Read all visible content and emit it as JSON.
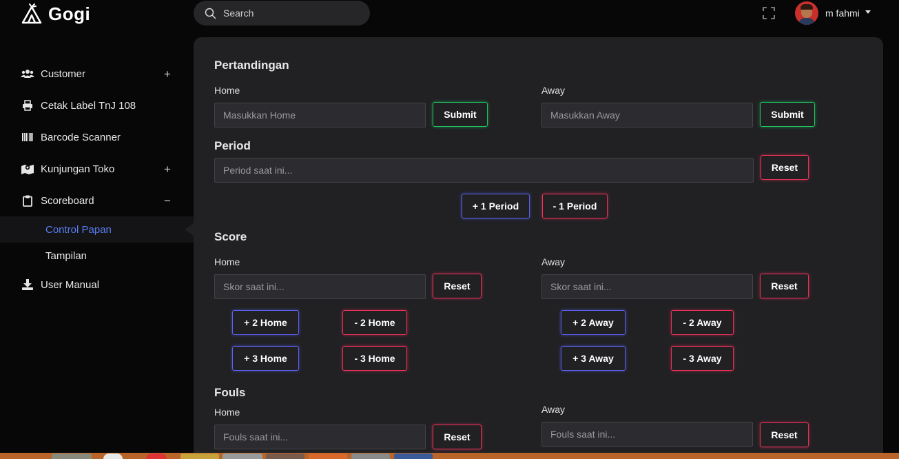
{
  "app": {
    "name": "Gogi"
  },
  "search": {
    "placeholder": "Search"
  },
  "user": {
    "name": "m fahmi"
  },
  "sidebar": {
    "items": [
      {
        "label": "Customer",
        "icon": "users-icon",
        "toggle": "+"
      },
      {
        "label": "Cetak Label TnJ 108",
        "icon": "printer-icon"
      },
      {
        "label": "Barcode Scanner",
        "icon": "barcode-icon"
      },
      {
        "label": "Kunjungan Toko",
        "icon": "map-icon",
        "toggle": "+"
      },
      {
        "label": "Scoreboard",
        "icon": "clipboard-icon",
        "toggle": "−"
      },
      {
        "label": "User Manual",
        "icon": "download-icon"
      }
    ],
    "subitems": [
      {
        "label": "Control Papan",
        "active": true
      },
      {
        "label": "Tampilan",
        "active": false
      }
    ]
  },
  "pertandingan": {
    "title": "Pertandingan",
    "home_label": "Home",
    "away_label": "Away",
    "home_placeholder": "Masukkan Home",
    "away_placeholder": "Masukkan Away",
    "submit_label": "Submit"
  },
  "period": {
    "title": "Period",
    "placeholder": "Period saat ini...",
    "reset_label": "Reset",
    "plus_label": "+ 1 Period",
    "minus_label": "- 1 Period"
  },
  "score": {
    "title": "Score",
    "home_label": "Home",
    "away_label": "Away",
    "placeholder": "Skor saat ini...",
    "reset_label": "Reset",
    "plus2_home": "+ 2 Home",
    "minus2_home": "- 2 Home",
    "plus3_home": "+ 3 Home",
    "minus3_home": "- 3 Home",
    "plus2_away": "+ 2 Away",
    "minus2_away": "- 2 Away",
    "plus3_away": "+ 3 Away",
    "minus3_away": "- 3 Away"
  },
  "fouls": {
    "title": "Fouls",
    "home_label": "Home",
    "away_label": "Away",
    "placeholder": "Fouls saat ini...",
    "reset_label": "Reset"
  },
  "colors": {
    "accent_green": "#22c55e",
    "accent_red": "#f0325a",
    "accent_blue": "#5b63f0",
    "active_link": "#5a7cf0",
    "card_bg": "#212124",
    "page_bg": "#070707"
  }
}
